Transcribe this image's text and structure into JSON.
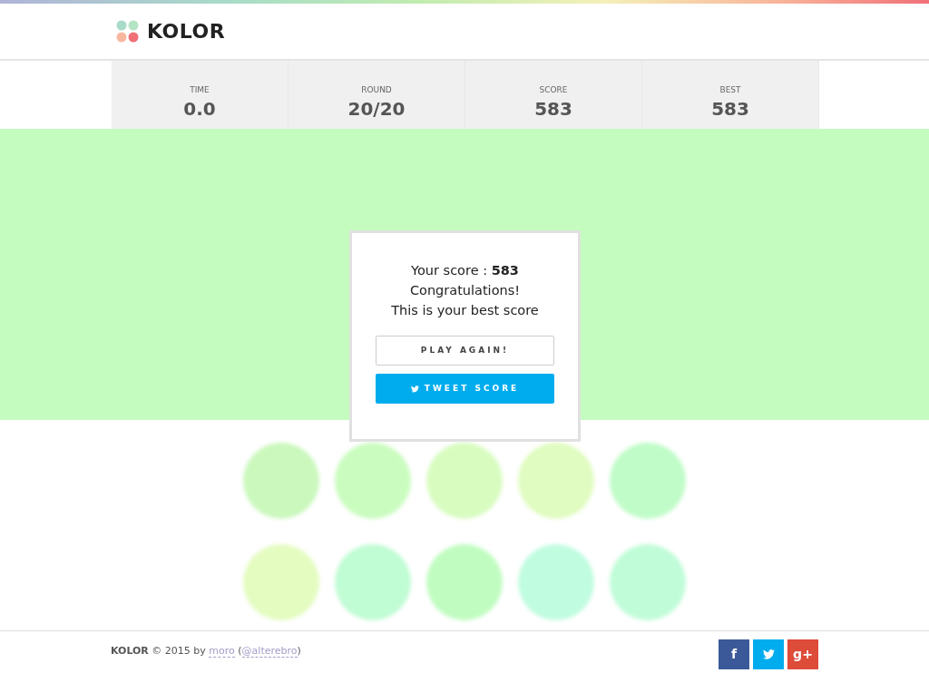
{
  "header": {
    "brand": "KOLOR"
  },
  "stats": [
    {
      "label": "TIME",
      "value": "0.0"
    },
    {
      "label": "ROUND",
      "value": "20/20"
    },
    {
      "label": "SCORE",
      "value": "583"
    },
    {
      "label": "BEST",
      "value": "583"
    }
  ],
  "target": {
    "color": "#c4fcbf"
  },
  "circles": [
    {
      "color": "#cbf8bd"
    },
    {
      "color": "#cafcbf"
    },
    {
      "color": "#d8fcc0"
    },
    {
      "color": "#e0fcc0"
    },
    {
      "color": "#c0fcc8"
    },
    {
      "color": "#e4fcc0"
    },
    {
      "color": "#c0fcd4"
    },
    {
      "color": "#c0fcc0"
    },
    {
      "color": "#c0fce0"
    },
    {
      "color": "#c0fcd8"
    }
  ],
  "modal": {
    "lines": [
      "Your score : **583**",
      "Congratulations!",
      "This is your best score"
    ],
    "play_button": "PLAY AGAIN!",
    "tweet_button": "TWEET SCORE"
  },
  "footer": {
    "prefix": "**KOLOR** © 2015 by ",
    "author": "moro",
    "open": " (",
    "handle": "@alterebro",
    "close": ")",
    "social": [
      {
        "kind": "facebook",
        "label": "f"
      },
      {
        "kind": "twitter"
      },
      {
        "kind": "googleplus",
        "label": "g+"
      }
    ]
  }
}
